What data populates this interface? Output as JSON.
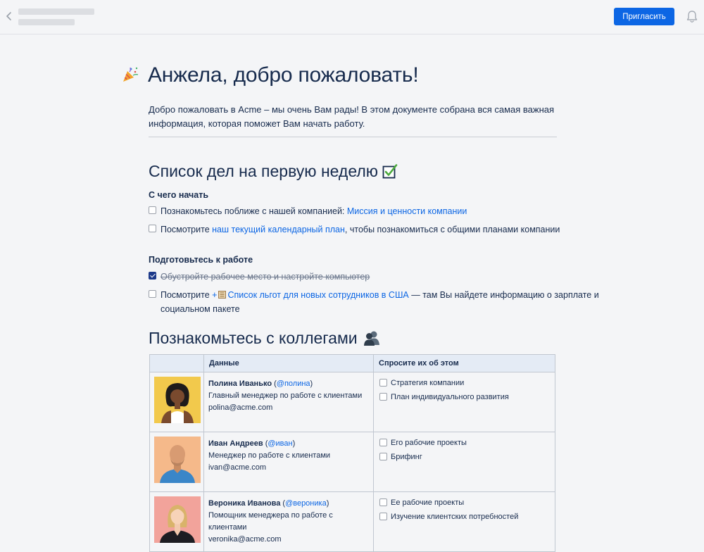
{
  "topbar": {
    "invite_label": "Пригласить"
  },
  "page": {
    "title": "Анжела, добро пожаловать!",
    "intro": "Добро пожаловать в Acme – мы очень Вам рады! В этом документе собрана вся самая важная информация, которая поможет Вам начать работу."
  },
  "todo": {
    "heading": "Список дел на первую неделю",
    "start": {
      "heading": "С чего начать",
      "task1": {
        "text": "Познакомьтесь поближе с нашей компанией: ",
        "link": "Миссия и ценности компании"
      },
      "task2": {
        "text_before": "Посмотрите ",
        "link": "наш текущий календарный план",
        "text_after": ", чтобы познакомиться с общими планами компании"
      }
    },
    "prepare": {
      "heading": "Подготовьтесь к работе",
      "task3": {
        "text": "Обустройте рабочее место и настройте компьютер",
        "checked": true
      },
      "task4": {
        "text_before": "Посмотрите ",
        "plus": "+",
        "link": "Список льгот для новых сотрудников в США",
        "text_after": " — там Вы найдете информацию о зарплате и социальном пакете"
      }
    }
  },
  "colleagues": {
    "heading": "Познакомьтесь с коллегами",
    "columns": [
      "",
      "Данные",
      "Спросите их об этом"
    ],
    "rows": [
      {
        "name": "Полина Иванько",
        "mention": "@полина",
        "role": "Главный менеджер по работе с клиентами",
        "email": "polina@acme.com",
        "ask1": "Стратегия компании",
        "ask2": "План индивидуального развития",
        "photo_bg": "#f2c94c"
      },
      {
        "name": "Иван Андреев",
        "mention": "@иван",
        "role": "Менеджер по работе с клиентами",
        "email": "ivan@acme.com",
        "ask1": "Его рабочие проекты",
        "ask2": "Брифинг",
        "photo_bg": "#f5b98a"
      },
      {
        "name": "Вероника Иванова",
        "mention": "@вероника",
        "role": "Помощник менеджера по работе с клиентами",
        "email": "veronika@acme.com",
        "ask1": "Ее рабочие проекты",
        "ask2": "Изучение клиентских потребностей",
        "photo_bg": "#f2a39b"
      }
    ]
  },
  "colors": {
    "primary": "#0c66e4",
    "text": "#172b4d",
    "checkbox_checked": "#1d3a8a"
  }
}
